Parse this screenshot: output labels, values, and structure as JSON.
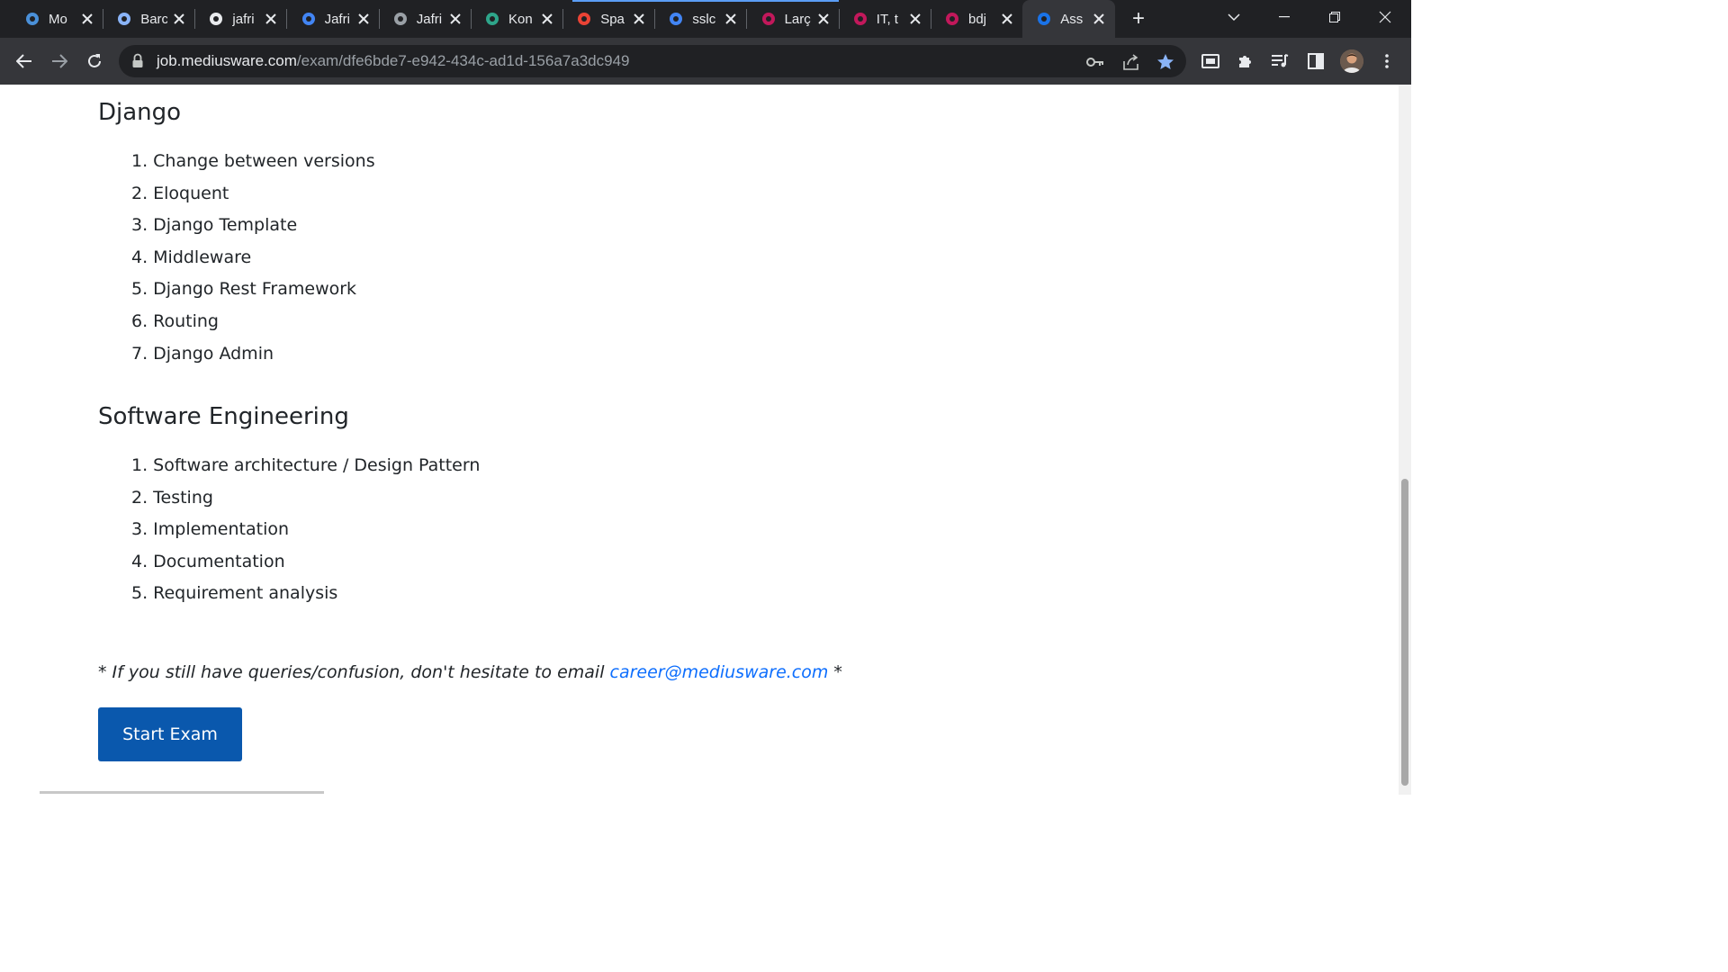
{
  "browser": {
    "tabs": [
      {
        "title": "Mo",
        "icon": "bot-icon",
        "color": "#4a90d9"
      },
      {
        "title": "Barc",
        "icon": "bard-sparkle-icon",
        "color": "#8ab4f8"
      },
      {
        "title": "jafri",
        "icon": "github-icon",
        "color": "#e8eaed"
      },
      {
        "title": "Jafri",
        "icon": "google-docs-icon",
        "color": "#4285f4"
      },
      {
        "title": "Jafri",
        "icon": "globe-icon",
        "color": "#9aa0a6"
      },
      {
        "title": "Kon",
        "icon": "send-icon",
        "color": "#2ea58a"
      },
      {
        "title": "Spa",
        "icon": "gmail-icon",
        "color": "#ea4335"
      },
      {
        "title": "sslc",
        "icon": "google-icon",
        "color": "#4285f4"
      },
      {
        "title": "Larç",
        "icon": "profile-icon",
        "color": "#c2185b"
      },
      {
        "title": "IT, t",
        "icon": "profile-icon",
        "color": "#c2185b"
      },
      {
        "title": "bdj",
        "icon": "profile-icon",
        "color": "#c2185b"
      },
      {
        "title": "Ass",
        "icon": "site-icon",
        "color": "#1a73e8"
      }
    ],
    "new_tab_label": "+",
    "url_host": "job.mediusware.com",
    "url_path": "/exam/dfe6bde7-e942-434c-ad1d-156a7a3dc949"
  },
  "page": {
    "sections": [
      {
        "title": "Django",
        "items": [
          "Change between versions",
          "Eloquent",
          "Django Template",
          "Middleware",
          "Django Rest Framework",
          "Routing",
          "Django Admin"
        ]
      },
      {
        "title": "Software Engineering",
        "items": [
          "Software architecture / Design Pattern",
          "Testing",
          "Implementation",
          "Documentation",
          "Requirement analysis"
        ]
      }
    ],
    "note_prefix": "* If you still have queries/confusion, don't hesitate to  email ",
    "note_email": "career@mediusware.com",
    "note_suffix": " *",
    "start_button": "Start Exam"
  },
  "colors": {
    "primary_button": "#0a58ad",
    "link": "#0d6efd",
    "bookmark_star": "#8ab4f8"
  }
}
